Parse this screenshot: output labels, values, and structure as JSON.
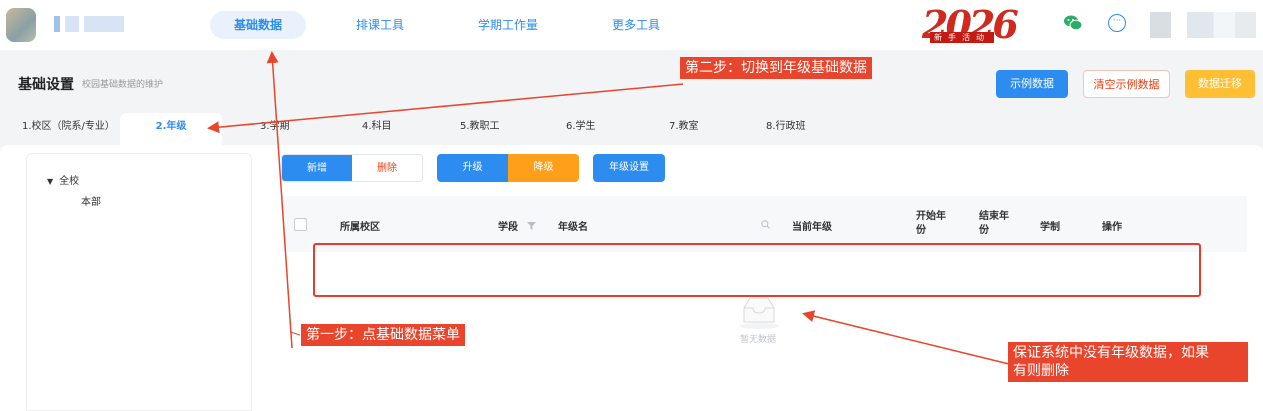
{
  "nav": {
    "items": [
      "基础数据",
      "排课工具",
      "学期工作量",
      "更多工具"
    ],
    "active_index": 0
  },
  "promo": {
    "year": "2026",
    "caption": "新手活动"
  },
  "header": {
    "title": "基础设置",
    "subtitle": "校园基础数据的维护",
    "sample_button": "示例数据",
    "clear_button": "清空示例数据",
    "migrate_button": "数据迁移"
  },
  "tabs": [
    "1.校区（院系/专业）",
    "2.年级",
    "3.学期",
    "4.科目",
    "5.教职工",
    "6.学生",
    "7.教室",
    "8.行政班"
  ],
  "active_tab": 1,
  "tree": {
    "root": "全校",
    "child": "本部"
  },
  "toolbar": {
    "add": "新增",
    "delete": "删除",
    "upgrade": "升级",
    "downgrade": "降级",
    "grade_settings": "年级设置"
  },
  "table": {
    "columns": [
      "所属校区",
      "学段",
      "年级名",
      "当前年级",
      "开始年份",
      "结束年份",
      "学制",
      "操作"
    ],
    "empty_text": "暂无数据"
  },
  "annotations": {
    "step1": "第一步：点基础数据菜单",
    "step2": "第二步：切换到年级基础数据",
    "note_line1": "保证系统中没有年级数据，如果",
    "note_line2": "有则删除"
  },
  "colors": {
    "primary": "#2d8cf0",
    "warning": "#ffbf35",
    "danger": "#ed4014",
    "orange": "#ff9f1a",
    "annotation": "#e8452c"
  }
}
